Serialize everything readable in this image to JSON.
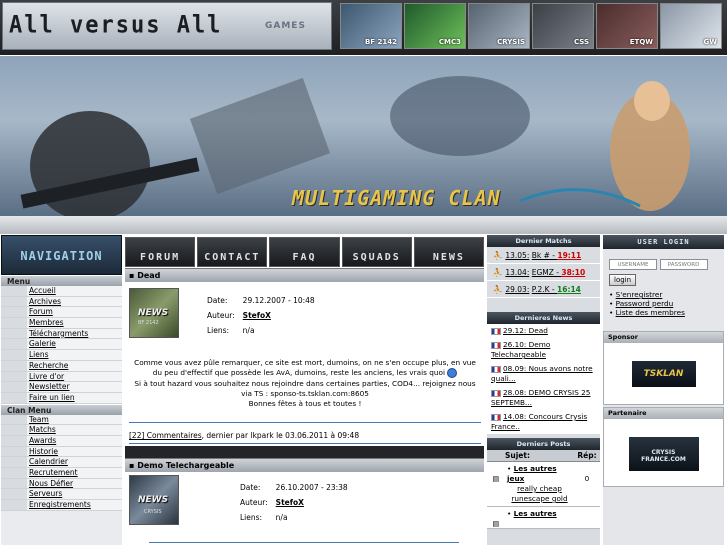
{
  "header": {
    "logo_text": "All versus All",
    "games_label": "GAMES",
    "game_tiles": [
      "BF 2142",
      "CMC3",
      "CRYSIS",
      "CSS",
      "ETQW",
      "GW"
    ]
  },
  "banner": {
    "title": "MULTIGAMING CLAN"
  },
  "nav": {
    "heading": "NAVIGATION",
    "menu_label": "Menu",
    "menu_items": [
      "Accueil",
      "Archives",
      "Forum",
      "Membres",
      "Téléchargments",
      "Galerie",
      "Liens",
      "Recherche",
      "Livre d'or",
      "Newsletter",
      "Faire un lien"
    ],
    "clan_label": "Clan Menu",
    "clan_items": [
      "Team",
      "Matchs",
      "Awards",
      "Historie",
      "Calendrier",
      "Recrutement",
      "Nous Défier",
      "Serveurs",
      "Enregistrements"
    ]
  },
  "menubar": [
    "FORUM",
    "CONTACT",
    "FAQ",
    "SQUADS",
    "NEWS"
  ],
  "news": [
    {
      "title": "Dead",
      "thumb_label": "NEWS",
      "thumb_sub": "BF 2142",
      "date_label": "Date:",
      "date": "29.12.2007 - 10:48",
      "author_label": "Auteur:",
      "author": "StefoX",
      "links_label": "Liens:",
      "links": "n/a",
      "body1": "Comme vous avez pûle remarquer, ce site est mort, dumoins, on ne s'en occupe plus, en vue du peu d'effectif que possède les AvA, dumoins, reste les anciens, les vrais quoi",
      "body2": "Si à tout hazard vous souhaitez nous rejoindre dans certaines parties, COD4... rejoignez nous via TS : sponso-ts.tsklan.com:8605",
      "body3": "Bonnes fêtes à tous et toutes !",
      "comments_link": "[22] Commentaires",
      "comments_tail": ", dernier par lkpark le 03.06.2011 à 09:48"
    },
    {
      "title": "Demo Telechargeable",
      "thumb_label": "NEWS",
      "thumb_sub": "CRYSIS",
      "date_label": "Date:",
      "date": "26.10.2007 - 23:38",
      "author_label": "Auteur:",
      "author": "StefoX",
      "links_label": "Liens:",
      "links": "n/a"
    }
  ],
  "matches": {
    "heading": "Dernier Matchs",
    "rows": [
      {
        "date": "13.05:",
        "name": "Bk # - ",
        "score": "19:11",
        "result": "loss"
      },
      {
        "date": "13.04:",
        "name": "EGMZ - ",
        "score": "38:10",
        "result": "draw"
      },
      {
        "date": "29.03:",
        "name": "P.2.K - ",
        "score": "16:14",
        "result": "win"
      }
    ]
  },
  "latest_news": {
    "heading": "Dernieres News",
    "items": [
      "29.12: Dead",
      "26.10: Demo Telechargeable",
      "08.09: Nous avons notre quali...",
      "28.08: DEMO CRYSIS 25 SEPTEMB...",
      "14.08: Concours Crysis France.."
    ]
  },
  "latest_posts": {
    "heading": "Derniers Posts",
    "col_subject": "Sujet:",
    "col_replies": "Rép:",
    "rows": [
      {
        "title": "Les autres jeux",
        "sub": "really cheap runescape gold",
        "replies": "0"
      },
      {
        "title": "Les autres",
        "sub": "",
        "replies": ""
      }
    ]
  },
  "login": {
    "heading": "USER LOGIN",
    "username_placeholder": "USERNAME",
    "password_placeholder": "PASSWORD",
    "button": "login",
    "links": [
      "S'enregistrer",
      "Password perdu",
      "Liste des membres"
    ]
  },
  "sponsor": {
    "heading": "Sponsor",
    "logo_text": "TSKLAN"
  },
  "partner": {
    "heading": "Partenaire",
    "logo_text": "CRYSIS FRANCE.COM"
  },
  "colors": {
    "accent": "#2b6fb5",
    "win": "#117a1a",
    "loss": "#cc0000",
    "draw": "#cc0000"
  }
}
